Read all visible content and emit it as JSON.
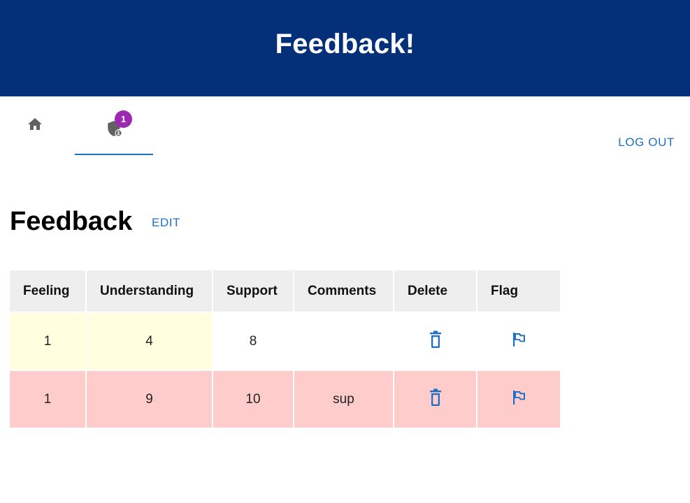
{
  "header": {
    "title": "Feedback!"
  },
  "nav": {
    "tabs": [
      {
        "name": "home",
        "icon": "home-icon"
      },
      {
        "name": "admin",
        "icon": "admin-shield-icon",
        "badge": "1",
        "active": true
      }
    ],
    "logout_label": "LOG OUT"
  },
  "section": {
    "title": "Feedback",
    "edit_label": "EDIT"
  },
  "table": {
    "headers": [
      "Feeling",
      "Understanding",
      "Support",
      "Comments",
      "Delete",
      "Flag"
    ],
    "rows": [
      {
        "feeling": "1",
        "understanding": "4",
        "support": "8",
        "comments": "",
        "flagged": false
      },
      {
        "feeling": "1",
        "understanding": "9",
        "support": "10",
        "comments": "sup",
        "flagged": true
      }
    ]
  },
  "colors": {
    "header_bg": "#033078",
    "accent": "#1f6fc4",
    "badge": "#9c27b0",
    "flagged_row": "#ffcccc",
    "low_score_cell": "#ffffe0",
    "table_header_bg": "#eeeeee"
  }
}
